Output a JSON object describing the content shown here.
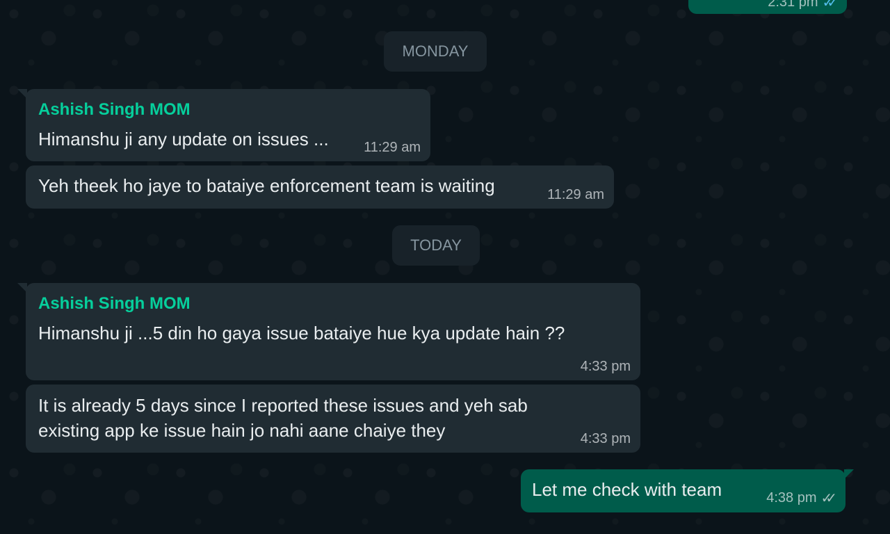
{
  "messages": {
    "prev_outgoing": {
      "time": "2:31 pm",
      "ticks": "✓✓"
    },
    "date_monday": "MONDAY",
    "msg1": {
      "sender": "Ashish Singh MOM",
      "text": "Himanshu ji any update on issues ...",
      "time": "11:29 am"
    },
    "msg2": {
      "text": "Yeh theek ho jaye to bataiye enforcement team is waiting",
      "time": "11:29 am"
    },
    "date_today": "TODAY",
    "msg3": {
      "sender": "Ashish Singh MOM",
      "text": "Himanshu ji ...5 din ho gaya issue bataiye hue kya update hain ??",
      "time": "4:33 pm"
    },
    "msg4": {
      "text_line1": "It is already 5 days since I reported these issues and yeh sab",
      "text_line2": "existing app ke issue hain jo nahi aane chaiye they",
      "time": "4:33 pm"
    },
    "msg5": {
      "text": "Let me check with team",
      "time": "4:38 pm",
      "ticks": "✓✓"
    }
  },
  "colors": {
    "background": "#0b141a",
    "incoming_bubble": "#202c33",
    "outgoing_bubble": "#005c4b",
    "sender_name": "#06cf9c",
    "read_ticks": "#53bdeb"
  }
}
